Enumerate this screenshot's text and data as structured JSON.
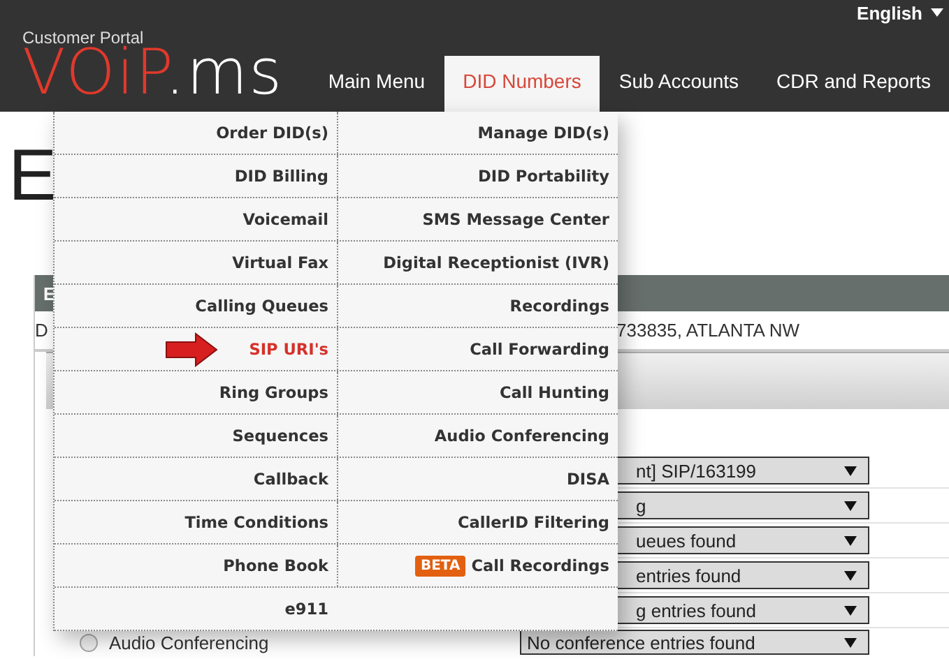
{
  "header": {
    "language": "English",
    "portal_label": "Customer Portal",
    "logo": {
      "part_1": "VOiP",
      "part_2": ".ms"
    }
  },
  "nav": [
    {
      "label": "Main Menu",
      "selected": false
    },
    {
      "label": "DID Numbers",
      "selected": true
    },
    {
      "label": "Sub Accounts",
      "selected": false
    },
    {
      "label": "CDR and Reports",
      "selected": false
    }
  ],
  "dropdown": {
    "rows": [
      [
        {
          "label": "Order DID(s)",
          "selected": false
        },
        {
          "label": "Manage DID(s)",
          "selected": false
        }
      ],
      [
        {
          "label": "DID Billing",
          "selected": false
        },
        {
          "label": "DID Portability",
          "selected": false
        }
      ],
      [
        {
          "label": "Voicemail",
          "selected": false
        },
        {
          "label": "SMS Message Center",
          "selected": false
        }
      ],
      [
        {
          "label": "Virtual Fax",
          "selected": false
        },
        {
          "label": "Digital Receptionist (IVR)",
          "selected": false
        }
      ],
      [
        {
          "label": "Calling Queues",
          "selected": false
        },
        {
          "label": "Recordings",
          "selected": false
        }
      ],
      [
        {
          "label": "SIP URI's",
          "selected": true
        },
        {
          "label": "Call Forwarding",
          "selected": false
        }
      ],
      [
        {
          "label": "Ring Groups",
          "selected": false
        },
        {
          "label": "Call Hunting",
          "selected": false
        }
      ],
      [
        {
          "label": "Sequences",
          "selected": false
        },
        {
          "label": "Audio Conferencing",
          "selected": false
        }
      ],
      [
        {
          "label": "Callback",
          "selected": false
        },
        {
          "label": "DISA",
          "selected": false
        }
      ],
      [
        {
          "label": "Time Conditions",
          "selected": false
        },
        {
          "label": "CallerID Filtering",
          "selected": false
        }
      ],
      [
        {
          "label": "Phone Book",
          "selected": false
        },
        {
          "label": "Call Recordings",
          "selected": false,
          "badge": "BETA"
        }
      ],
      [
        {
          "label": "e911",
          "selected": false
        }
      ]
    ]
  },
  "page": {
    "heading": "E",
    "panel": {
      "title": "E",
      "info_left": "D",
      "info_right": "733835, ATLANTA NW",
      "rows": [
        {
          "value": "nt] SIP/163199"
        },
        {
          "value": "g"
        },
        {
          "value": "ueues found"
        },
        {
          "value": "entries found"
        },
        {
          "value": "g entries found"
        },
        {
          "label": "Audio Conferencing",
          "selected": false,
          "value": "No conference entries found"
        }
      ]
    }
  }
}
